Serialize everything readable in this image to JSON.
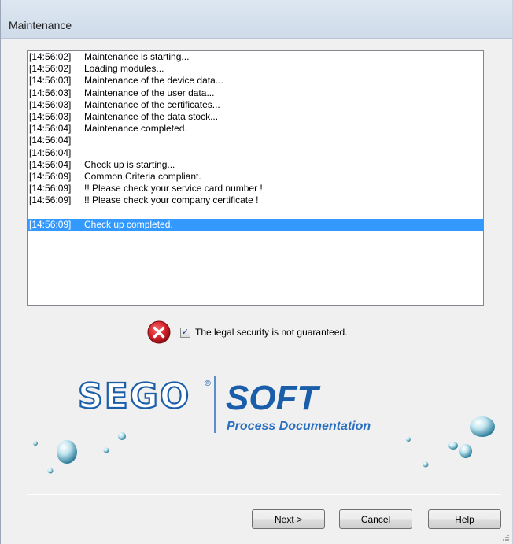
{
  "window": {
    "title": "Maintenance"
  },
  "log": {
    "entries": [
      {
        "time": "[14:56:02]",
        "message": "Maintenance is starting...",
        "selected": false
      },
      {
        "time": "[14:56:02]",
        "message": "Loading modules...",
        "selected": false
      },
      {
        "time": "[14:56:03]",
        "message": "Maintenance of the device data...",
        "selected": false
      },
      {
        "time": "[14:56:03]",
        "message": "Maintenance of the user data...",
        "selected": false
      },
      {
        "time": "[14:56:03]",
        "message": "Maintenance of the certificates...",
        "selected": false
      },
      {
        "time": "[14:56:03]",
        "message": "Maintenance of the data stock...",
        "selected": false
      },
      {
        "time": "[14:56:04]",
        "message": "Maintenance completed.",
        "selected": false
      },
      {
        "time": "[14:56:04]",
        "message": "",
        "selected": false
      },
      {
        "time": "[14:56:04]",
        "message": "",
        "selected": false
      },
      {
        "time": "[14:56:04]",
        "message": "Check up is starting...",
        "selected": false
      },
      {
        "time": "[14:56:09]",
        "message": "Common Criteria compliant.",
        "selected": false
      },
      {
        "time": "[14:56:09]",
        "message": "!! Please check your service card number !",
        "selected": false
      },
      {
        "time": "[14:56:09]",
        "message": "!! Please check your company certificate !",
        "selected": false
      },
      {
        "time": "",
        "message": "",
        "selected": false
      },
      {
        "time": "[14:56:09]",
        "message": "Check up completed.",
        "selected": true
      }
    ]
  },
  "status": {
    "icon": "error-icon",
    "checkbox_checked": true,
    "text": "The legal security is not guaranteed."
  },
  "logo": {
    "brand": "SEGO",
    "registered": "®",
    "product": "SOFT",
    "tagline": "Process Documentation",
    "colors": {
      "brand": "#1a5da8",
      "accent": "#2a6fc0"
    }
  },
  "buttons": {
    "next": "Next >",
    "cancel": "Cancel",
    "help": "Help"
  },
  "colors": {
    "selection": "#3399ff",
    "error": "#d6202a"
  }
}
